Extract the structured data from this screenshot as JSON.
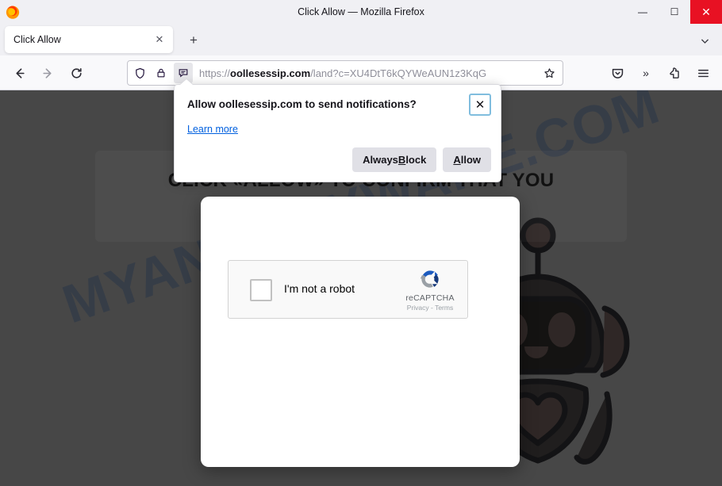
{
  "window": {
    "title": "Click Allow — Mozilla Firefox",
    "minimize_label": "—",
    "maximize_label": "☐",
    "close_label": "✕"
  },
  "tabbar": {
    "tab_title": "Click Allow",
    "tab_close_label": "✕",
    "new_tab_label": "+",
    "list_all_tabs_label": "∨"
  },
  "toolbar": {
    "back_label": "←",
    "forward_label": "→",
    "reload_label": "↻",
    "url_scheme": "https://",
    "url_host": "oollesessip.com",
    "url_path": "/land?c=XU4DtT6kQYWeAUN1z3KqG",
    "bookmark_label": "☆",
    "overflow_label": "»"
  },
  "page": {
    "headline": "CLICK «ALLOW» TO CONFIRM THAT YOU",
    "watermark": "MYANTISPYWARE.COM"
  },
  "captcha": {
    "checkbox_label": "I'm not a robot",
    "brand_name": "reCAPTCHA",
    "links_text": "Privacy - Terms"
  },
  "permission_dialog": {
    "title": "Allow oollesessip.com to send notifications?",
    "learn_more": "Learn more",
    "close_label": "✕",
    "block_prefix": "Always ",
    "block_accesskey": "B",
    "block_suffix": "lock",
    "allow_accesskey": "A",
    "allow_suffix": "llow"
  },
  "colors": {
    "close_button_red": "#e81123",
    "link_blue": "#0060df",
    "focus_border": "#80bdde",
    "overlay": "#3b3b3b",
    "watermark_blue": "#a9c6ef",
    "recaptcha_blue": "#1c5bbf",
    "recaptcha_gray": "#9aa0a6"
  }
}
